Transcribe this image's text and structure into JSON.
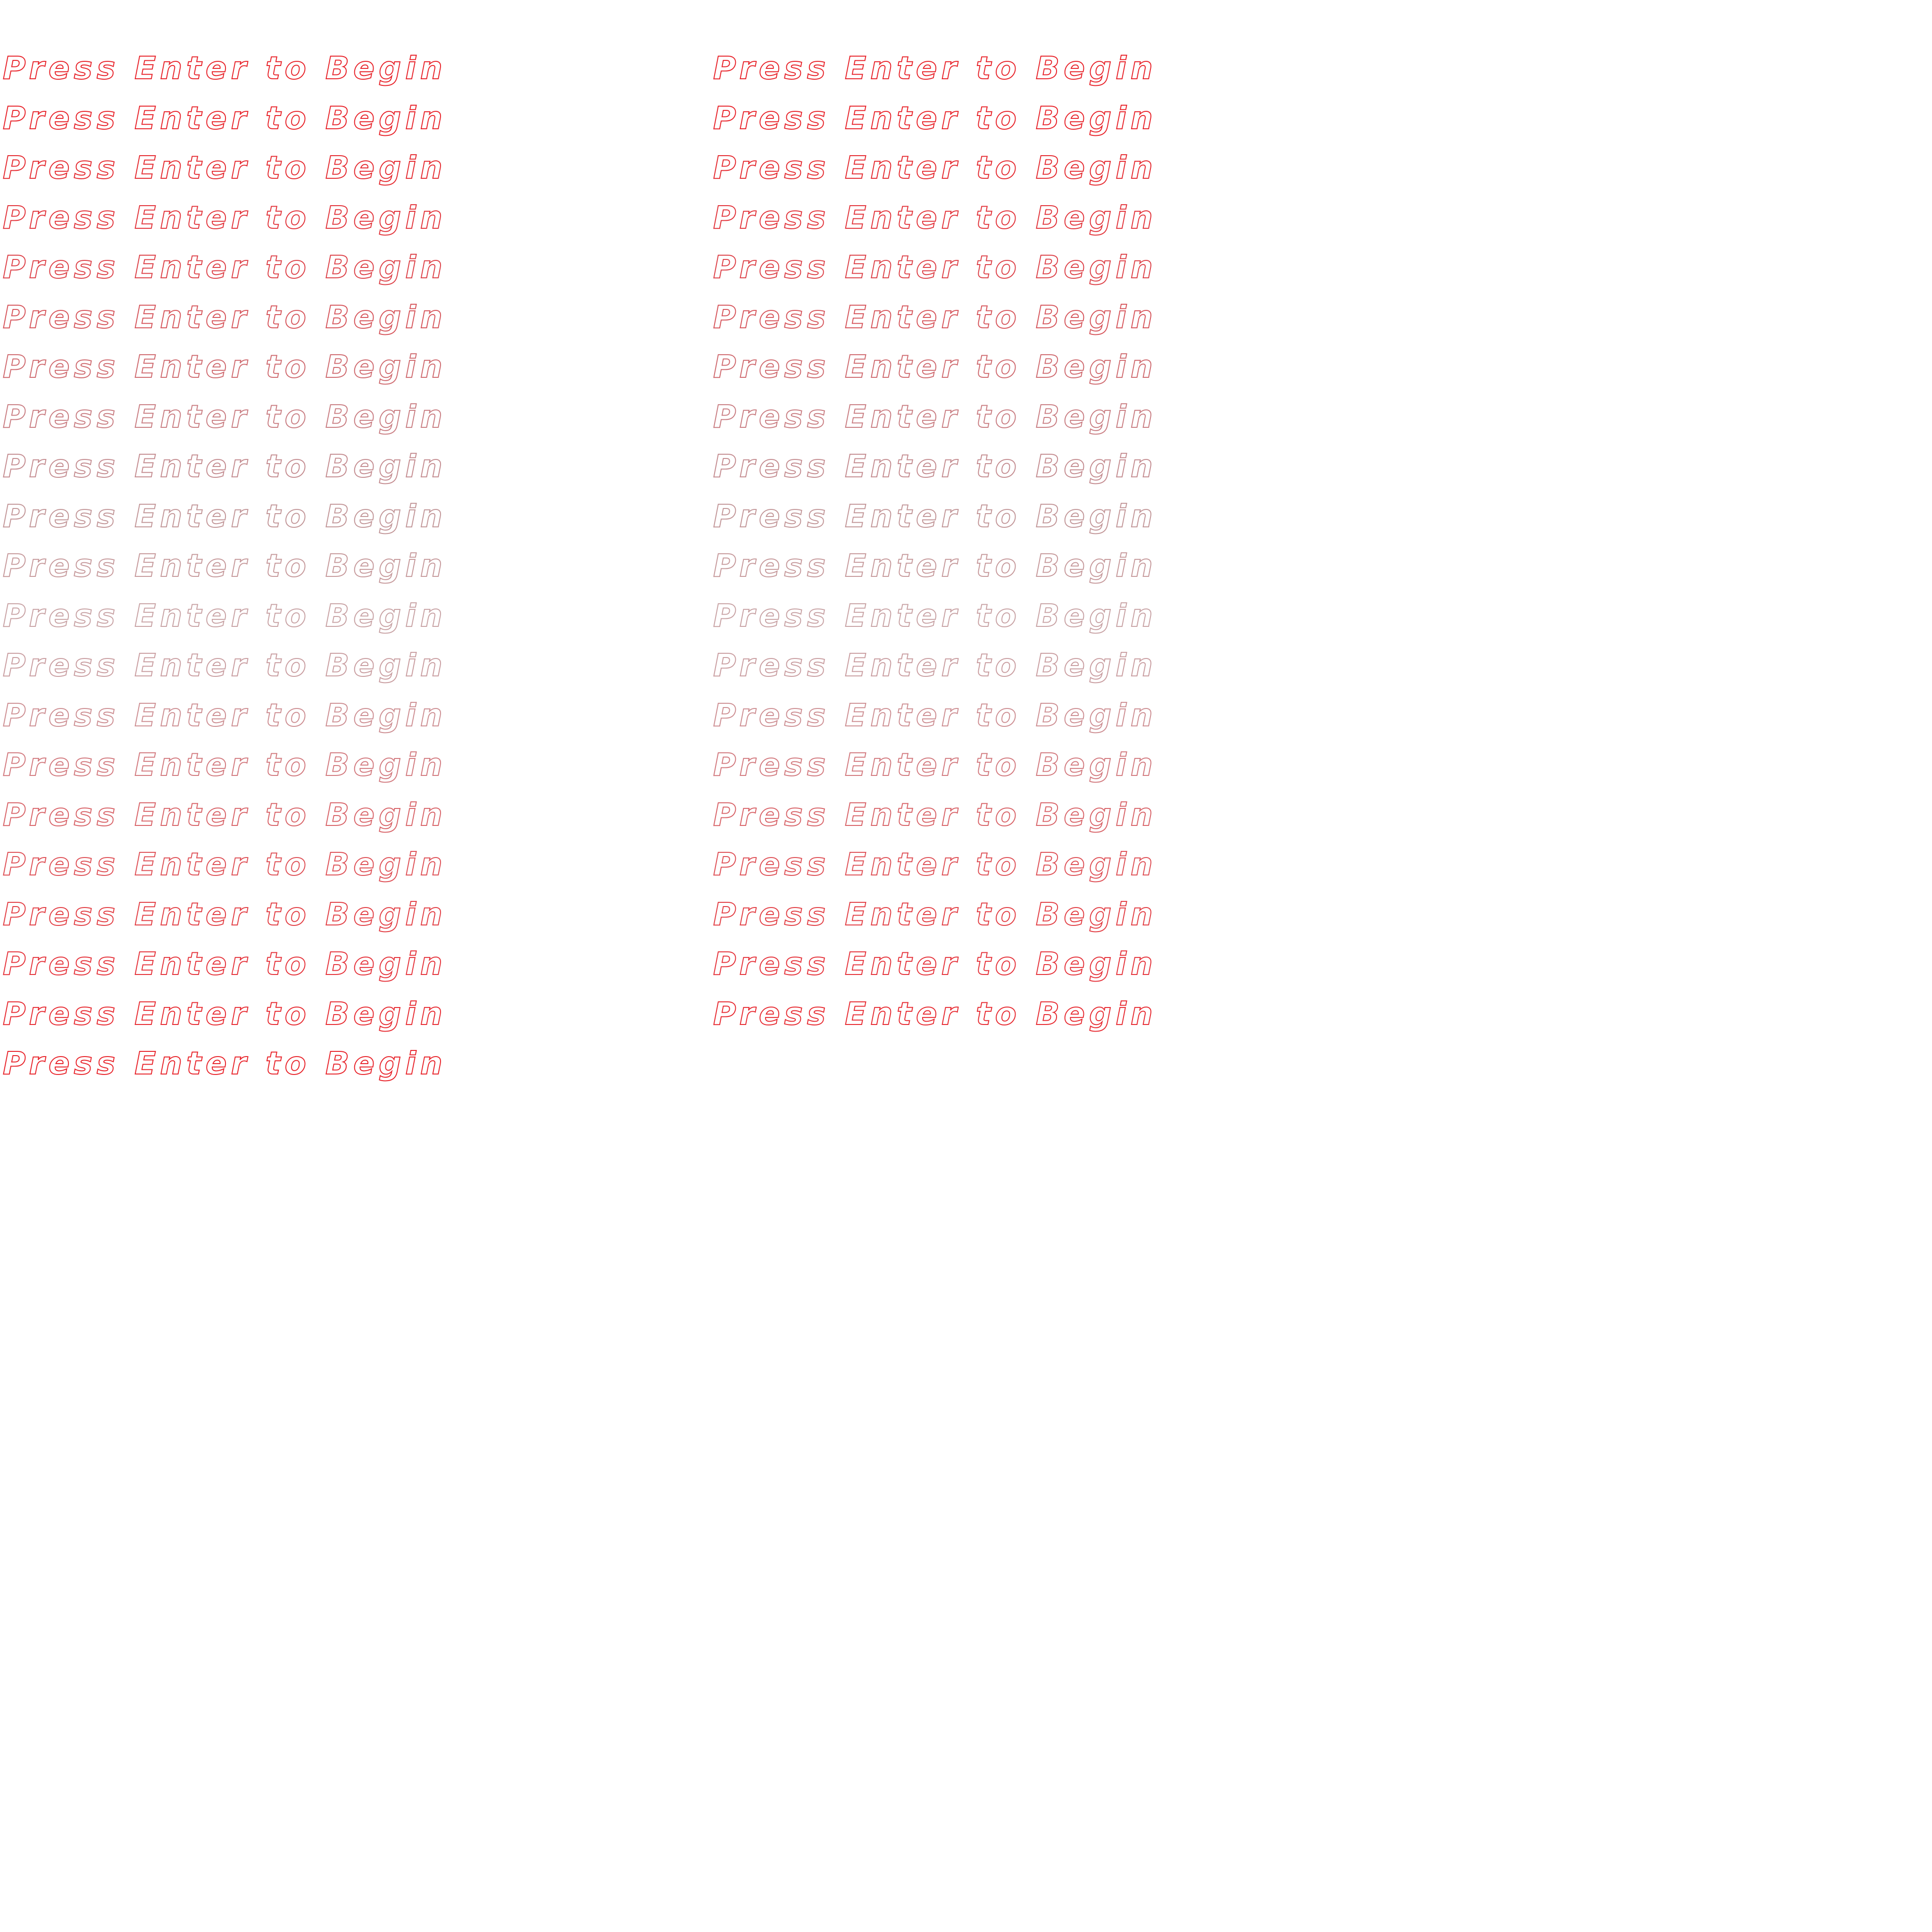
{
  "game": {
    "start_prompt": "Press Enter to Begin",
    "left_column_count": 21,
    "right_column_count": 20,
    "colors": {
      "background": "#ffffff",
      "outline_bright": "#e8232a",
      "outline_faded": "#c9a8aa"
    },
    "row_colors": [
      "#e8232a",
      "#e8232a",
      "#e52a30",
      "#e2333a",
      "#dd4148",
      "#d6555b",
      "#cf6a6f",
      "#c97d82",
      "#c48c90",
      "#c29698",
      "#c6999b",
      "#c8a2a4",
      "#c99da0",
      "#cd8e92",
      "#d2797e",
      "#d86368",
      "#de4f55",
      "#e23d43",
      "#e5323a",
      "#e72a31",
      "#e8232a"
    ]
  }
}
